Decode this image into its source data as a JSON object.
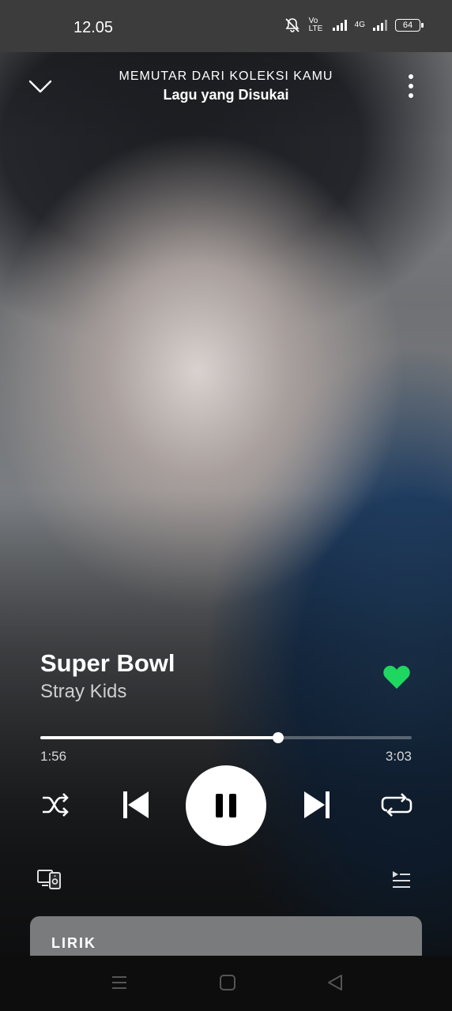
{
  "status_bar": {
    "time": "12.05",
    "volte": "Vo LTE",
    "network": "4G",
    "battery": "64"
  },
  "header": {
    "context_label": "MEMUTAR DARI KOLEKSI KAMU",
    "playlist_title": "Lagu yang Disukai"
  },
  "track": {
    "title": "Super Bowl",
    "artist": "Stray Kids",
    "liked": true,
    "elapsed": "1:56",
    "duration": "3:03",
    "progress_fraction": 0.64
  },
  "lyrics": {
    "label": "LIRIK"
  },
  "colors": {
    "accent_green": "#1ED760",
    "lyrics_card": "#7a7b7d"
  },
  "icons": [
    "chevron-down-icon",
    "more-vertical-icon",
    "heart-icon",
    "shuffle-icon",
    "previous-icon",
    "pause-icon",
    "next-icon",
    "repeat-icon",
    "devices-icon",
    "queue-icon",
    "nav-menu-icon",
    "nav-home-icon",
    "nav-back-icon"
  ]
}
